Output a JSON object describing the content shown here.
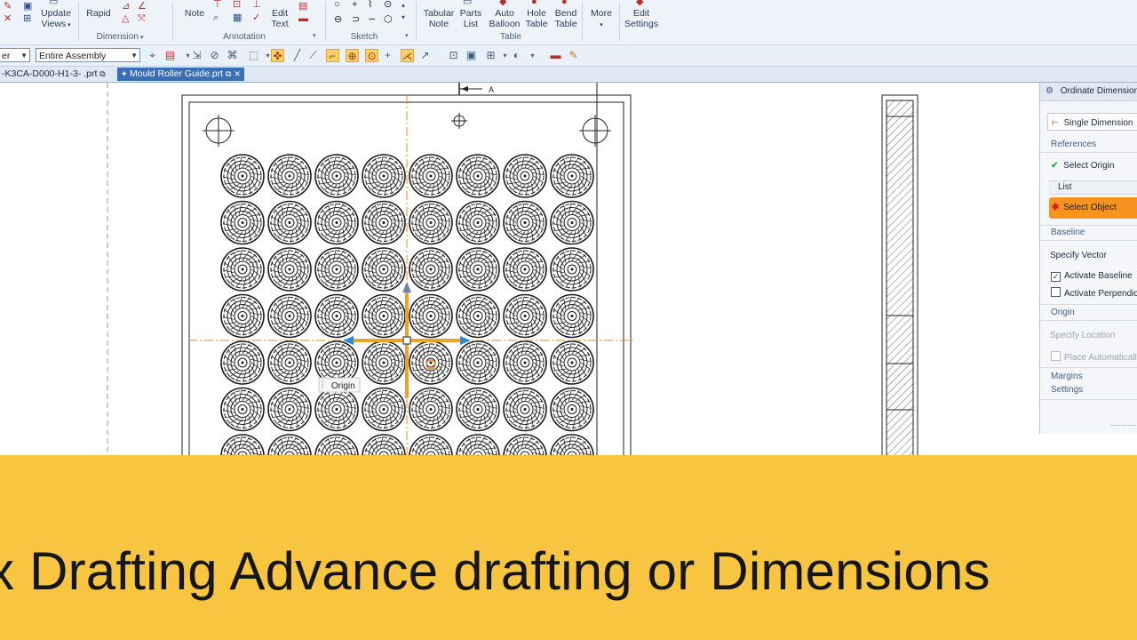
{
  "ribbon": {
    "update_views": "Update\nViews",
    "rapid": "Rapid",
    "note": "Note",
    "edit_text": "Edit\nText",
    "tabular_note": "Tabular\nNote",
    "parts_list": "Parts\nList",
    "auto_balloon": "Auto\nBalloon",
    "hole_table": "Hole\nTable",
    "bend_table": "Bend\nTable",
    "more": "More",
    "edit_settings": "Edit\nSettings",
    "groups": {
      "dimension": "Dimension",
      "annotation": "Annotation",
      "sketch": "Sketch",
      "table": "Table"
    }
  },
  "toolbar": {
    "filter_value": "er",
    "scope_value": "Entire Assembly"
  },
  "tabs": [
    {
      "label": "-K3CA-D000-H1-3- .prt"
    },
    {
      "label": "Mould Roller Guide.prt"
    }
  ],
  "drawing": {
    "section_label": "A",
    "origin_tooltip": "Origin",
    "hole_rows": 8,
    "hole_cols": 8
  },
  "panel": {
    "title": "Ordinate Dimension",
    "mode": "Single Dimension",
    "references": "References",
    "select_origin": "Select Origin",
    "list": "List",
    "select_object": "Select Object",
    "baseline": "Baseline",
    "specify_vector": "Specify Vector",
    "activate_baseline": "Activate Baseline",
    "activate_perpendicular": "Activate Perpendicu",
    "origin": "Origin",
    "specify_location": "Specify Location",
    "place_automatically": "Place Automatically",
    "margins": "Margins",
    "settings": "Settings"
  },
  "banner": {
    "text": "x Drafting Advance drafting or Dimensions"
  },
  "colors": {
    "banner": "#f7c133",
    "accent_orange": "#f08a1c",
    "tab_active": "#3a6fb6",
    "select_object_bg": "#f7931e"
  }
}
